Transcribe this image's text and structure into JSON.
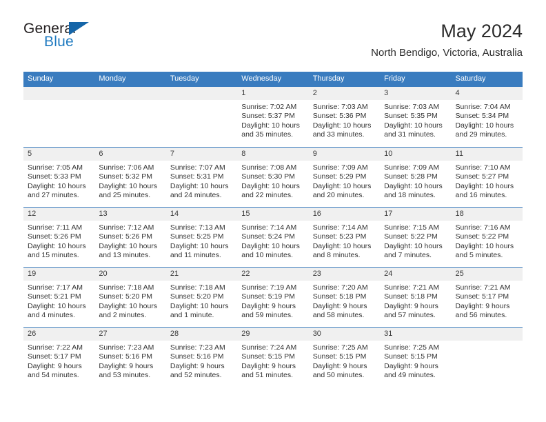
{
  "brand": {
    "line1": "General",
    "line2": "Blue",
    "triangle_color": "#1565a8",
    "blue_text_color": "#1f7ac0"
  },
  "header": {
    "title": "May 2024",
    "subtitle": "North Bendigo, Victoria, Australia"
  },
  "colors": {
    "header_blue": "#3a7cbf",
    "daynum_band": "#f0f0f0",
    "text": "#333333"
  },
  "weekdays": [
    "Sunday",
    "Monday",
    "Tuesday",
    "Wednesday",
    "Thursday",
    "Friday",
    "Saturday"
  ],
  "weeks": [
    [
      {
        "day": "",
        "lines": [
          "",
          "",
          "",
          ""
        ]
      },
      {
        "day": "",
        "lines": [
          "",
          "",
          "",
          ""
        ]
      },
      {
        "day": "",
        "lines": [
          "",
          "",
          "",
          ""
        ]
      },
      {
        "day": "1",
        "lines": [
          "Sunrise: 7:02 AM",
          "Sunset: 5:37 PM",
          "Daylight: 10 hours",
          "and 35 minutes."
        ]
      },
      {
        "day": "2",
        "lines": [
          "Sunrise: 7:03 AM",
          "Sunset: 5:36 PM",
          "Daylight: 10 hours",
          "and 33 minutes."
        ]
      },
      {
        "day": "3",
        "lines": [
          "Sunrise: 7:03 AM",
          "Sunset: 5:35 PM",
          "Daylight: 10 hours",
          "and 31 minutes."
        ]
      },
      {
        "day": "4",
        "lines": [
          "Sunrise: 7:04 AM",
          "Sunset: 5:34 PM",
          "Daylight: 10 hours",
          "and 29 minutes."
        ]
      }
    ],
    [
      {
        "day": "5",
        "lines": [
          "Sunrise: 7:05 AM",
          "Sunset: 5:33 PM",
          "Daylight: 10 hours",
          "and 27 minutes."
        ]
      },
      {
        "day": "6",
        "lines": [
          "Sunrise: 7:06 AM",
          "Sunset: 5:32 PM",
          "Daylight: 10 hours",
          "and 25 minutes."
        ]
      },
      {
        "day": "7",
        "lines": [
          "Sunrise: 7:07 AM",
          "Sunset: 5:31 PM",
          "Daylight: 10 hours",
          "and 24 minutes."
        ]
      },
      {
        "day": "8",
        "lines": [
          "Sunrise: 7:08 AM",
          "Sunset: 5:30 PM",
          "Daylight: 10 hours",
          "and 22 minutes."
        ]
      },
      {
        "day": "9",
        "lines": [
          "Sunrise: 7:09 AM",
          "Sunset: 5:29 PM",
          "Daylight: 10 hours",
          "and 20 minutes."
        ]
      },
      {
        "day": "10",
        "lines": [
          "Sunrise: 7:09 AM",
          "Sunset: 5:28 PM",
          "Daylight: 10 hours",
          "and 18 minutes."
        ]
      },
      {
        "day": "11",
        "lines": [
          "Sunrise: 7:10 AM",
          "Sunset: 5:27 PM",
          "Daylight: 10 hours",
          "and 16 minutes."
        ]
      }
    ],
    [
      {
        "day": "12",
        "lines": [
          "Sunrise: 7:11 AM",
          "Sunset: 5:26 PM",
          "Daylight: 10 hours",
          "and 15 minutes."
        ]
      },
      {
        "day": "13",
        "lines": [
          "Sunrise: 7:12 AM",
          "Sunset: 5:26 PM",
          "Daylight: 10 hours",
          "and 13 minutes."
        ]
      },
      {
        "day": "14",
        "lines": [
          "Sunrise: 7:13 AM",
          "Sunset: 5:25 PM",
          "Daylight: 10 hours",
          "and 11 minutes."
        ]
      },
      {
        "day": "15",
        "lines": [
          "Sunrise: 7:14 AM",
          "Sunset: 5:24 PM",
          "Daylight: 10 hours",
          "and 10 minutes."
        ]
      },
      {
        "day": "16",
        "lines": [
          "Sunrise: 7:14 AM",
          "Sunset: 5:23 PM",
          "Daylight: 10 hours",
          "and 8 minutes."
        ]
      },
      {
        "day": "17",
        "lines": [
          "Sunrise: 7:15 AM",
          "Sunset: 5:22 PM",
          "Daylight: 10 hours",
          "and 7 minutes."
        ]
      },
      {
        "day": "18",
        "lines": [
          "Sunrise: 7:16 AM",
          "Sunset: 5:22 PM",
          "Daylight: 10 hours",
          "and 5 minutes."
        ]
      }
    ],
    [
      {
        "day": "19",
        "lines": [
          "Sunrise: 7:17 AM",
          "Sunset: 5:21 PM",
          "Daylight: 10 hours",
          "and 4 minutes."
        ]
      },
      {
        "day": "20",
        "lines": [
          "Sunrise: 7:18 AM",
          "Sunset: 5:20 PM",
          "Daylight: 10 hours",
          "and 2 minutes."
        ]
      },
      {
        "day": "21",
        "lines": [
          "Sunrise: 7:18 AM",
          "Sunset: 5:20 PM",
          "Daylight: 10 hours",
          "and 1 minute."
        ]
      },
      {
        "day": "22",
        "lines": [
          "Sunrise: 7:19 AM",
          "Sunset: 5:19 PM",
          "Daylight: 9 hours",
          "and 59 minutes."
        ]
      },
      {
        "day": "23",
        "lines": [
          "Sunrise: 7:20 AM",
          "Sunset: 5:18 PM",
          "Daylight: 9 hours",
          "and 58 minutes."
        ]
      },
      {
        "day": "24",
        "lines": [
          "Sunrise: 7:21 AM",
          "Sunset: 5:18 PM",
          "Daylight: 9 hours",
          "and 57 minutes."
        ]
      },
      {
        "day": "25",
        "lines": [
          "Sunrise: 7:21 AM",
          "Sunset: 5:17 PM",
          "Daylight: 9 hours",
          "and 56 minutes."
        ]
      }
    ],
    [
      {
        "day": "26",
        "lines": [
          "Sunrise: 7:22 AM",
          "Sunset: 5:17 PM",
          "Daylight: 9 hours",
          "and 54 minutes."
        ]
      },
      {
        "day": "27",
        "lines": [
          "Sunrise: 7:23 AM",
          "Sunset: 5:16 PM",
          "Daylight: 9 hours",
          "and 53 minutes."
        ]
      },
      {
        "day": "28",
        "lines": [
          "Sunrise: 7:23 AM",
          "Sunset: 5:16 PM",
          "Daylight: 9 hours",
          "and 52 minutes."
        ]
      },
      {
        "day": "29",
        "lines": [
          "Sunrise: 7:24 AM",
          "Sunset: 5:15 PM",
          "Daylight: 9 hours",
          "and 51 minutes."
        ]
      },
      {
        "day": "30",
        "lines": [
          "Sunrise: 7:25 AM",
          "Sunset: 5:15 PM",
          "Daylight: 9 hours",
          "and 50 minutes."
        ]
      },
      {
        "day": "31",
        "lines": [
          "Sunrise: 7:25 AM",
          "Sunset: 5:15 PM",
          "Daylight: 9 hours",
          "and 49 minutes."
        ]
      },
      {
        "day": "",
        "lines": [
          "",
          "",
          "",
          ""
        ]
      }
    ]
  ]
}
